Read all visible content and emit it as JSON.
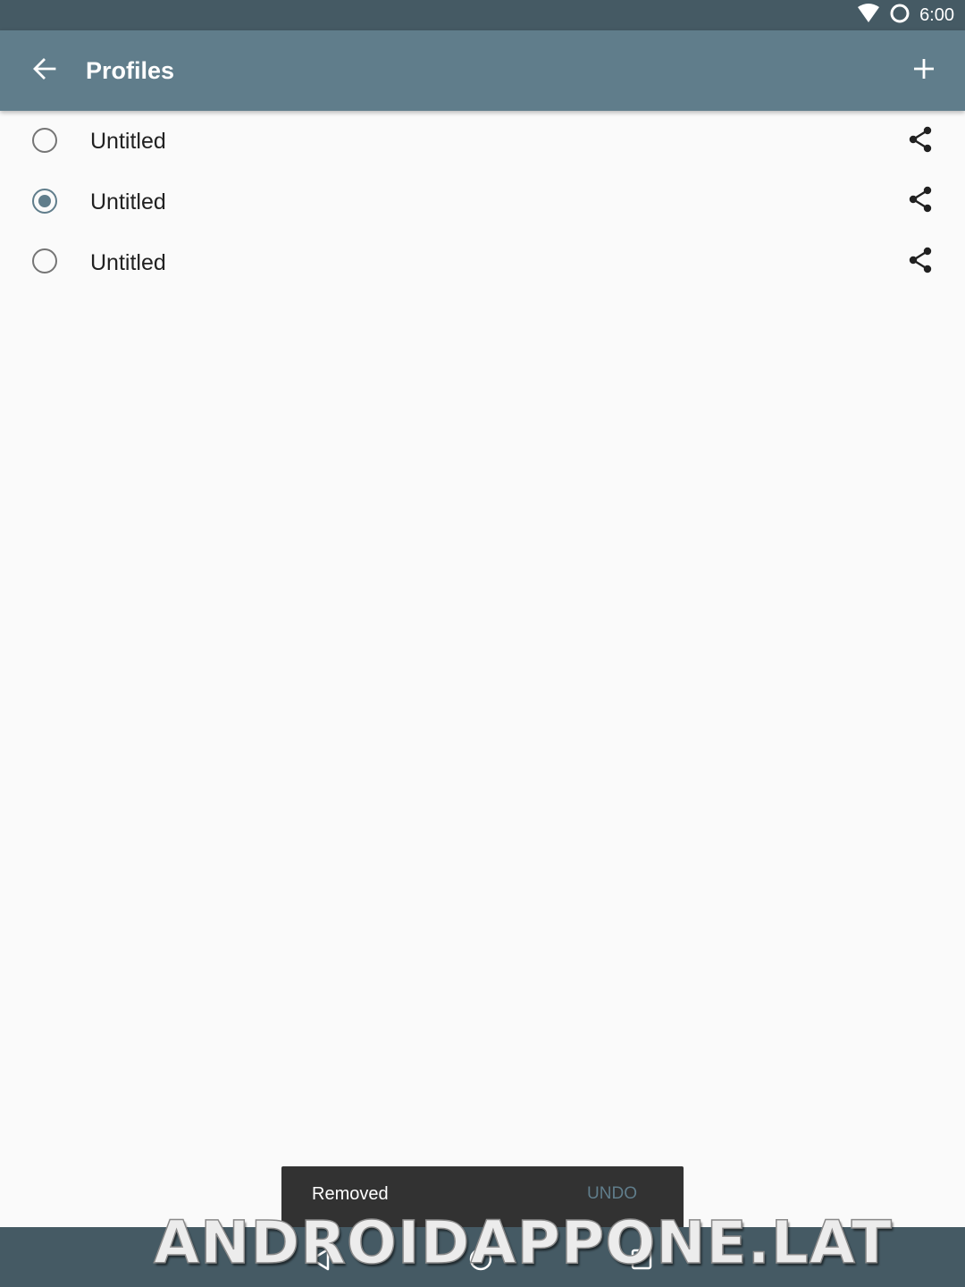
{
  "status_bar": {
    "time": "6:00",
    "icons": [
      "wifi-icon",
      "sync-ring-icon"
    ]
  },
  "app_bar": {
    "title": "Profiles",
    "back_icon": "arrow-back-icon",
    "add_icon": "plus-icon",
    "background": "#607d8b"
  },
  "profiles": [
    {
      "name": "Untitled",
      "selected": false
    },
    {
      "name": "Untitled",
      "selected": true
    },
    {
      "name": "Untitled",
      "selected": false
    }
  ],
  "snackbar": {
    "message": "Removed",
    "action": "UNDO"
  },
  "nav_bar": {
    "icons": [
      "nav-back-icon",
      "nav-home-icon",
      "nav-recents-icon"
    ]
  },
  "watermark": {
    "text": "ANDROIDAPPONE.LAT"
  },
  "colors": {
    "status_bar": "#455a64",
    "accent": "#607d8b",
    "background": "#fafafa",
    "snackbar": "#323232"
  }
}
